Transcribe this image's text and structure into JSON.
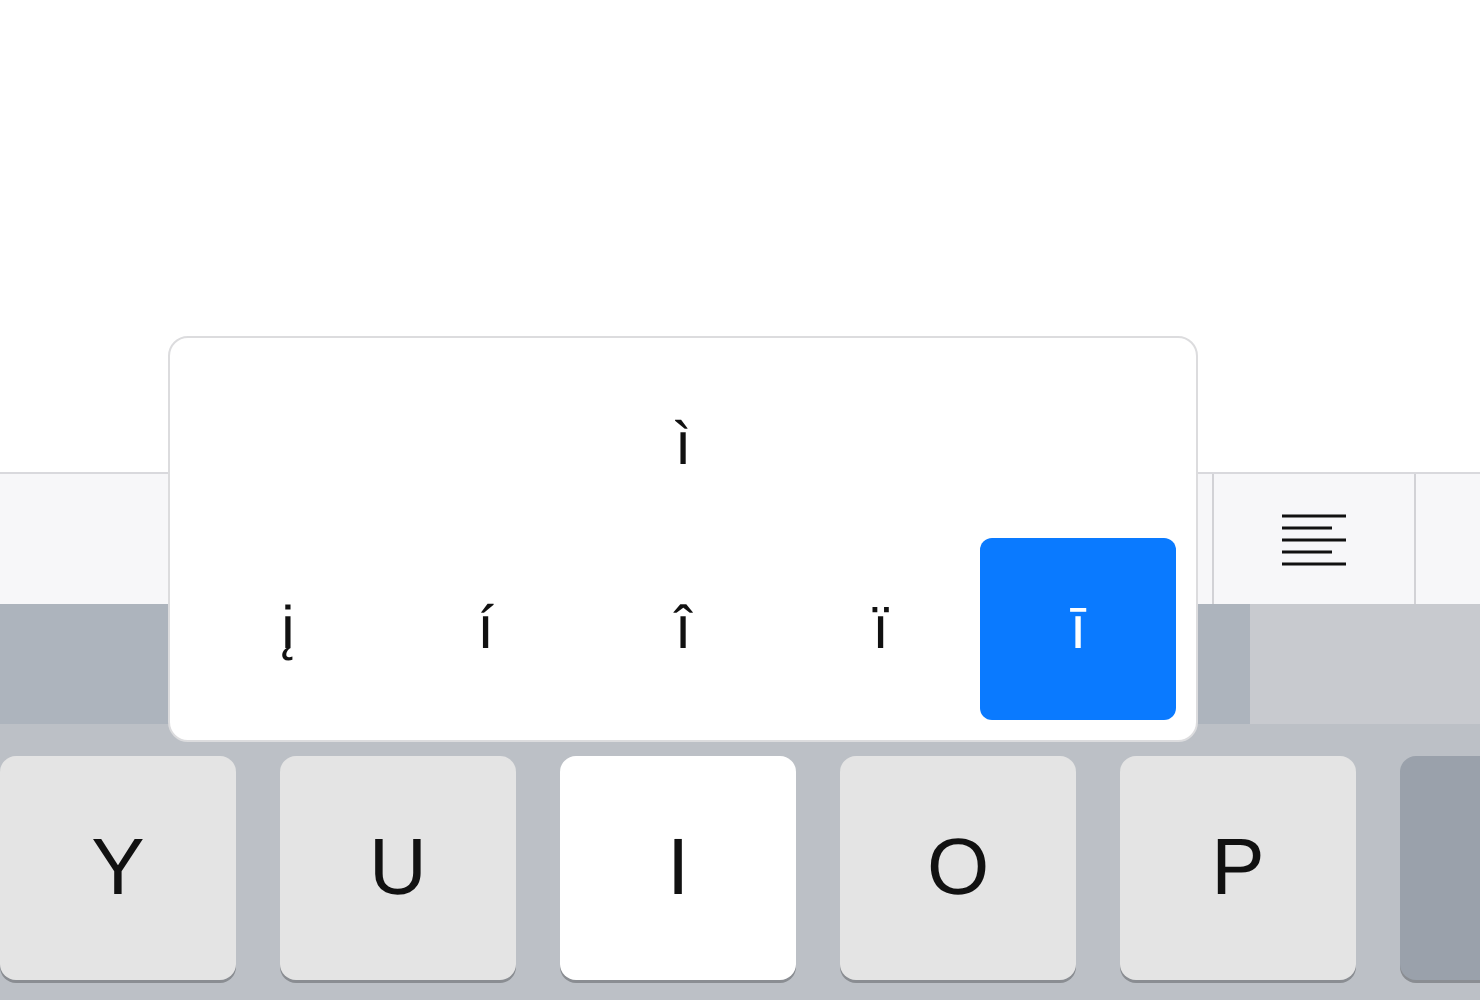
{
  "accent_popup": {
    "top_options": [
      {
        "label": "ì",
        "selected": false
      }
    ],
    "options": [
      {
        "label": "į",
        "selected": false
      },
      {
        "label": "í",
        "selected": false
      },
      {
        "label": "î",
        "selected": false
      },
      {
        "label": "ï",
        "selected": false
      },
      {
        "label": "ī",
        "selected": true
      }
    ]
  },
  "keys": [
    {
      "label": "Y",
      "pressed": false
    },
    {
      "label": "U",
      "pressed": false
    },
    {
      "label": "I",
      "pressed": true
    },
    {
      "label": "O",
      "pressed": false
    },
    {
      "label": "P",
      "pressed": false
    }
  ]
}
